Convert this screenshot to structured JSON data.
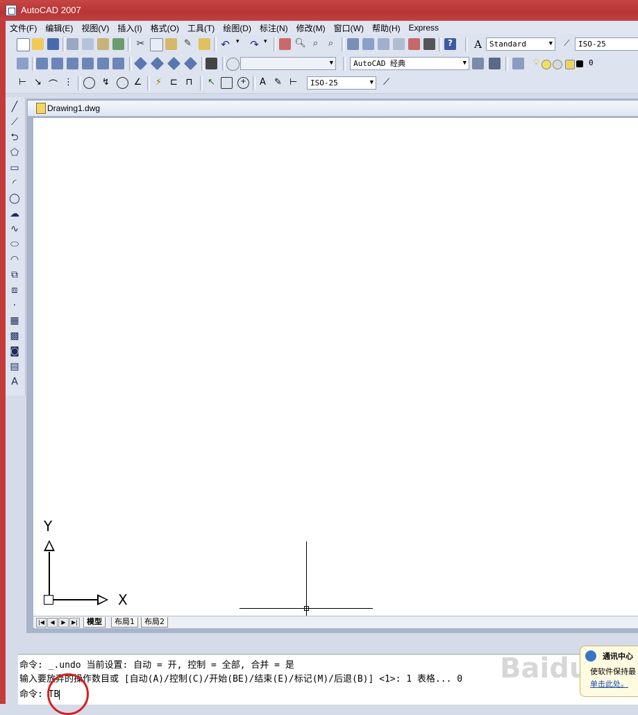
{
  "window": {
    "title": "AutoCAD 2007"
  },
  "menu": [
    "文件(F)",
    "编辑(E)",
    "视图(V)",
    "插入(I)",
    "格式(O)",
    "工具(T)",
    "绘图(D)",
    "标注(N)",
    "修改(M)",
    "窗口(W)",
    "帮助(H)",
    "Express"
  ],
  "toolbar1": {
    "text_style": "Standard",
    "dim_style": "ISO-25"
  },
  "toolbar2": {
    "workspace": "AutoCAD 经典",
    "layer": "0"
  },
  "toolbar3": {
    "dim_style": "ISO-25"
  },
  "drawing": {
    "tab_title": "Drawing1.dwg",
    "ucs_y": "Y",
    "ucs_x": "X"
  },
  "layout_tabs": [
    "模型",
    "布局1",
    "布局2"
  ],
  "command": {
    "line1": "命令: _.undo 当前设置: 自动 = 开, 控制 = 全部, 合并 = 是",
    "line2": "输入要放弃的操作数目或 [自动(A)/控制(C)/开始(BE)/结束(E)/标记(M)/后退(B)] <1>: 1 表格... 0",
    "prompt": "命令:",
    "input": "TB"
  },
  "notification": {
    "title": "通讯中心",
    "body": "使软件保持最",
    "link": "单击此处。"
  },
  "watermark": "Baidu 经验",
  "colors": {
    "title_bar": "#b83535",
    "highlight_circle": "#d62020"
  }
}
